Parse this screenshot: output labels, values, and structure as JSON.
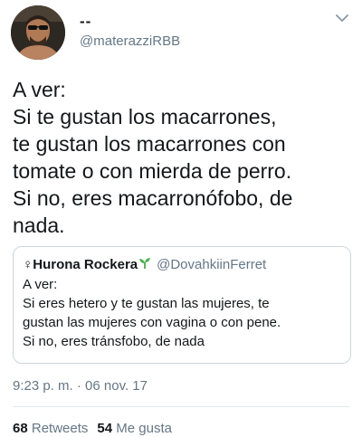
{
  "author": {
    "display_name": "--",
    "handle": "@materazziRBB"
  },
  "tweet": {
    "text": "A ver:\nSi te gustan los macarrones,\nte gustan los macarrones con\ntomate o con mierda de perro.\nSi no, eres macarronófobo, de\nnada.",
    "timestamp": "9:23 p. m. · 06 nov. 17"
  },
  "quoted_tweet": {
    "display_name": "♀Hurona Rockera",
    "handle": "@DovahkiinFerret",
    "text": "A ver:\nSi eres hetero y te gustan las mujeres, te\ngustan las mujeres con vagina o con pene.\nSi no, eres tránsfobo, de nada"
  },
  "stats": {
    "retweets_count": "68",
    "retweets_label": "Retweets",
    "likes_count": "54",
    "likes_label": "Me gusta"
  },
  "icons": {
    "caret": "chevron-down-icon",
    "sprout": "seedling-icon",
    "avatar": "user-avatar"
  },
  "colors": {
    "text": "#14171a",
    "secondary": "#657786",
    "border": "#ccd6dd",
    "sprout": "#3a9a3a"
  }
}
